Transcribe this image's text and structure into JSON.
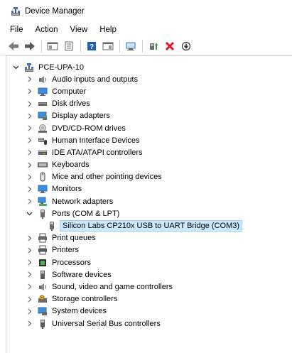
{
  "window": {
    "title": "Device Manager"
  },
  "menu": [
    "File",
    "Action",
    "View",
    "Help"
  ],
  "toolbar": {
    "buttons": [
      "back-arrow-icon",
      "forward-arrow-icon",
      "show-hide-console-tree-icon",
      "properties-icon",
      "help-icon",
      "show-action-pane-icon",
      "scan-hardware-icon",
      "update-driver-icon",
      "uninstall-icon",
      "enable-device-icon"
    ]
  },
  "tree": {
    "root": {
      "label": "PCE-UPA-10",
      "icon": "computer-icon",
      "expanded": true
    },
    "categories": [
      {
        "label": "Audio inputs and outputs",
        "icon": "speaker-icon",
        "expanded": false
      },
      {
        "label": "Computer",
        "icon": "monitor-icon",
        "expanded": false
      },
      {
        "label": "Disk drives",
        "icon": "disk-drive-icon",
        "expanded": false
      },
      {
        "label": "Display adapters",
        "icon": "display-adapter-icon",
        "expanded": false
      },
      {
        "label": "DVD/CD-ROM drives",
        "icon": "dvd-drive-icon",
        "expanded": false
      },
      {
        "label": "Human Interface Devices",
        "icon": "hid-icon",
        "expanded": false
      },
      {
        "label": "IDE ATA/ATAPI controllers",
        "icon": "ide-controller-icon",
        "expanded": false
      },
      {
        "label": "Keyboards",
        "icon": "keyboard-icon",
        "expanded": false
      },
      {
        "label": "Mice and other pointing devices",
        "icon": "mouse-icon",
        "expanded": false
      },
      {
        "label": "Monitors",
        "icon": "monitor-icon",
        "expanded": false
      },
      {
        "label": "Network adapters",
        "icon": "network-adapter-icon",
        "expanded": false
      },
      {
        "label": "Ports (COM & LPT)",
        "icon": "port-icon",
        "expanded": true,
        "children": [
          {
            "label": "Silicon Labs CP210x USB to UART Bridge (COM3)",
            "icon": "port-device-icon",
            "selected": true
          }
        ]
      },
      {
        "label": "Print queues",
        "icon": "print-queue-icon",
        "expanded": false
      },
      {
        "label": "Printers",
        "icon": "printer-icon",
        "expanded": false
      },
      {
        "label": "Processors",
        "icon": "processor-icon",
        "expanded": false
      },
      {
        "label": "Software devices",
        "icon": "software-device-icon",
        "expanded": false
      },
      {
        "label": "Sound, video and game controllers",
        "icon": "sound-controller-icon",
        "expanded": false
      },
      {
        "label": "Storage controllers",
        "icon": "storage-controller-icon",
        "expanded": false
      },
      {
        "label": "System devices",
        "icon": "system-devices-icon",
        "expanded": false
      },
      {
        "label": "Universal Serial Bus controllers",
        "icon": "usb-icon",
        "expanded": false
      }
    ]
  },
  "colors": {
    "selection_bg": "#cce8ff",
    "selection_border": "#99d1ff",
    "accent_blue": "#0078d7",
    "uninstall_red": "#e81123",
    "update_green": "#2e9e3e"
  }
}
